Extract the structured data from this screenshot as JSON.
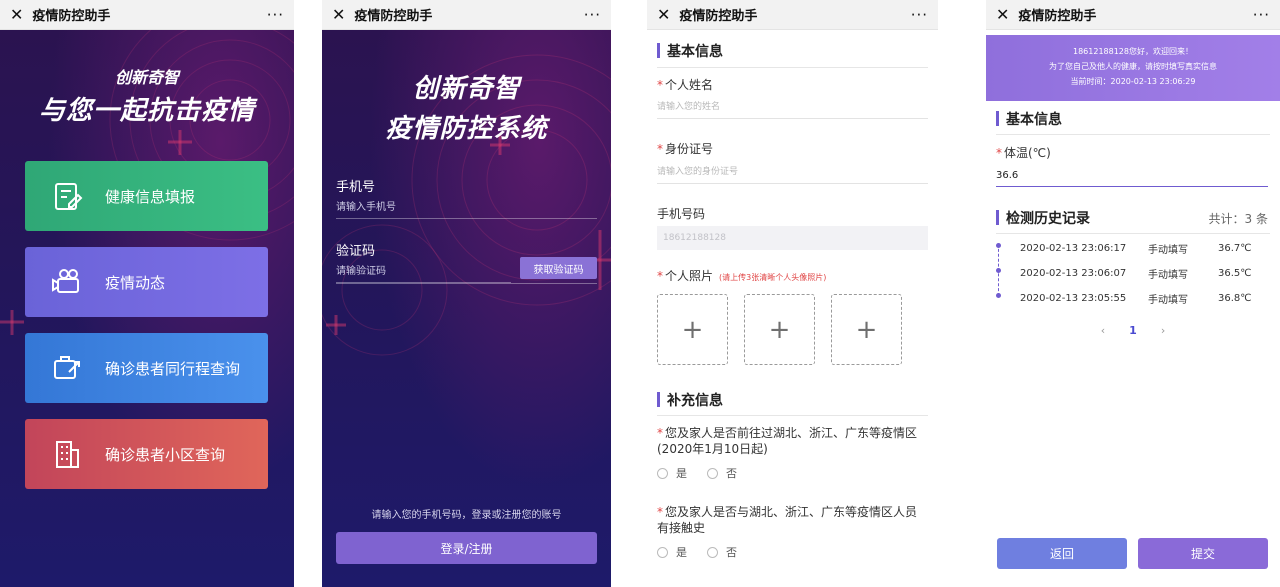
{
  "app": {
    "title": "疫情防控助手",
    "close_glyph": "✕",
    "more_glyph": "···"
  },
  "screen1": {
    "subtitle": "创新奇智",
    "headline": "与您一起抗击疫情",
    "cards": [
      {
        "label": "健康信息填报",
        "icon": "health-form-icon"
      },
      {
        "label": "疫情动态",
        "icon": "camera-news-icon"
      },
      {
        "label": "确诊患者同行程查询",
        "icon": "travel-check-icon"
      },
      {
        "label": "确诊患者小区查询",
        "icon": "building-icon"
      }
    ]
  },
  "screen2": {
    "title_line1": "创新奇智",
    "title_line2": "疫情防控系统",
    "phone_label": "手机号",
    "phone_placeholder": "请输入手机号",
    "code_label": "验证码",
    "code_placeholder": "请输验证码",
    "get_code_button": "获取验证码",
    "hint": "请输入您的手机号码，登录或注册您的账号",
    "login_button": "登录/注册"
  },
  "screen3": {
    "basic_title": "基本信息",
    "name_label": "个人姓名",
    "name_placeholder": "请输入您的姓名",
    "id_label": "身份证号",
    "id_placeholder": "请输入您的身份证号",
    "phone_label": "手机号码",
    "phone_value": "18612188128",
    "photo_label": "个人照片",
    "photo_note": "(请上传3张清晰个人头像照片)",
    "upload_glyph": "+",
    "extra_title": "补充信息",
    "question1": "您及家人是否前往过湖北、浙江、广东等疫情区(2020年1月10日起)",
    "question2": "您及家人是否与湖北、浙江、广东等疫情区人员有接触史",
    "yes": "是",
    "no": "否"
  },
  "screen4": {
    "banner_line1": "18612188128您好，欢迎回来！",
    "banner_line2": "为了您自己及他人的健康，请按时填写真实信息",
    "banner_line3": "当前时间：2020-02-13 23:06:29",
    "basic_title": "基本信息",
    "temp_label": "体温(℃)",
    "temp_value": "36.6",
    "history_title": "检测历史记录",
    "count_text": "共计：3 条",
    "history": [
      {
        "date": "2020-02-13 23:06:17",
        "method": "手动填写",
        "value": "36.7℃"
      },
      {
        "date": "2020-02-13 23:06:07",
        "method": "手动填写",
        "value": "36.5℃"
      },
      {
        "date": "2020-02-13 23:05:55",
        "method": "手动填写",
        "value": "36.8℃"
      }
    ],
    "pager": {
      "prev": "‹",
      "current": "1",
      "next": "›"
    },
    "back_button": "返回",
    "submit_button": "提交"
  }
}
